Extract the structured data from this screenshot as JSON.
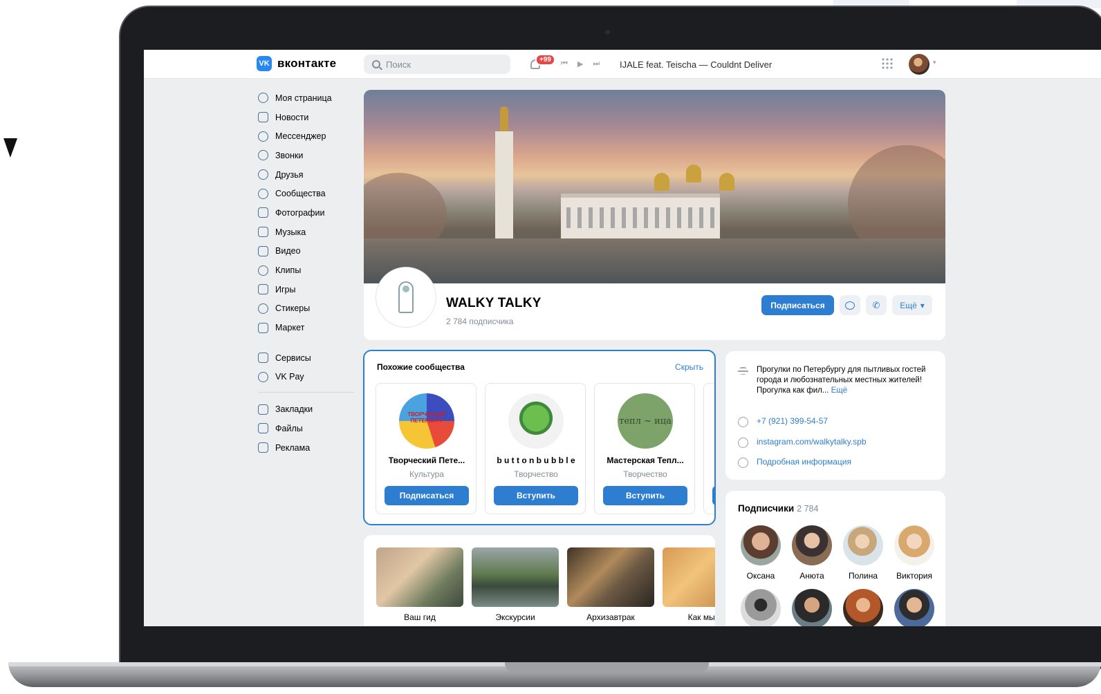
{
  "header": {
    "logo_text": "вконтакте",
    "logo_mark": "VK",
    "search_placeholder": "Поиск",
    "notifications_badge": "+99",
    "now_playing": "IJALE feat. Teischa — Couldnt Deliver"
  },
  "nav": {
    "items": [
      {
        "label": "Моя страница",
        "icon": "user-circle-icon"
      },
      {
        "label": "Новости",
        "icon": "newspaper-icon"
      },
      {
        "label": "Мессенджер",
        "icon": "chat-bubble-icon"
      },
      {
        "label": "Звонки",
        "icon": "phone-icon"
      },
      {
        "label": "Друзья",
        "icon": "friends-icon"
      },
      {
        "label": "Сообщества",
        "icon": "communities-icon"
      },
      {
        "label": "Фотографии",
        "icon": "photo-icon"
      },
      {
        "label": "Музыка",
        "icon": "music-icon"
      },
      {
        "label": "Видео",
        "icon": "video-icon"
      },
      {
        "label": "Клипы",
        "icon": "clips-icon"
      },
      {
        "label": "Игры",
        "icon": "gamepad-icon"
      },
      {
        "label": "Стикеры",
        "icon": "smile-icon"
      },
      {
        "label": "Маркет",
        "icon": "bag-icon"
      }
    ],
    "secondary": [
      {
        "label": "Сервисы",
        "icon": "services-icon"
      },
      {
        "label": "VK Pay",
        "icon": "vkpay-icon"
      }
    ],
    "tertiary": [
      {
        "label": "Закладки",
        "icon": "bookmark-icon"
      },
      {
        "label": "Файлы",
        "icon": "file-icon"
      },
      {
        "label": "Реклама",
        "icon": "megaphone-icon"
      }
    ]
  },
  "group": {
    "name": "WALKY TALKY",
    "subscribers": "2 784 подписчика",
    "subscribe_label": "Подписаться",
    "more_label": "Ещё"
  },
  "similar": {
    "title": "Похожие сообщества",
    "hide_label": "Скрыть",
    "cards": [
      {
        "name": "Творческий Пете...",
        "category": "Культура",
        "button": "Подписаться",
        "avatar_text": "ТВОРЧЕСКИЙ ПЕТЕРБУРГ"
      },
      {
        "name": "b u t t o n b u b b l e",
        "category": "Творчество",
        "button": "Вступить"
      },
      {
        "name": "Мастерская Тепл...",
        "category": "Творчество",
        "button": "Вступить",
        "avatar_text": "тепл ~ ица"
      }
    ]
  },
  "albums": [
    {
      "label": "Ваш гид"
    },
    {
      "label": "Экскурсии"
    },
    {
      "label": "Архизавтрак"
    },
    {
      "label": "Как мы гу"
    }
  ],
  "info": {
    "description": "Прогулки по Петербургу для пытливых гостей города и любознательных местных жителей! Прогулка как фил...",
    "description_more": "Ещё",
    "phone": "+7 (921) 399-54-57",
    "link": "instagram.com/walkytalky.spb",
    "details": "Подробная информация"
  },
  "subscribers": {
    "title": "Подписчики",
    "count": "2 784",
    "people": [
      {
        "name": "Оксана"
      },
      {
        "name": "Анюта"
      },
      {
        "name": "Полина"
      },
      {
        "name": "Виктория"
      }
    ]
  },
  "colors": {
    "accent": "#2d7ed1",
    "background": "#edeef0",
    "badge": "#e64646"
  }
}
